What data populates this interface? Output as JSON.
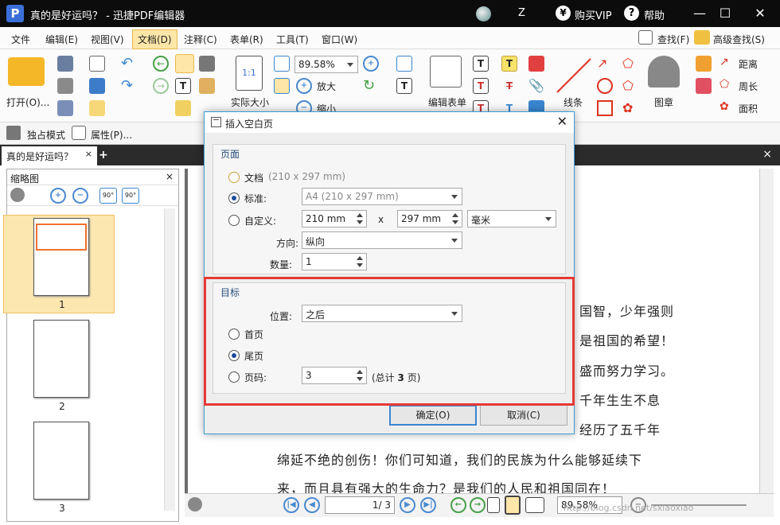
{
  "window": {
    "title": "真的是好运吗？ - 迅捷PDF编辑器",
    "logo": "P",
    "user": "Z",
    "vip_label": "购买VIP",
    "vip_icon": "¥",
    "help_label": "帮助",
    "help_icon": "?"
  },
  "menu": {
    "items": [
      "文件",
      "编辑(E)",
      "视图(V)",
      "文档(D)",
      "注释(C)",
      "表单(R)",
      "工具(T)",
      "窗口(W)"
    ],
    "find": "查找(F)",
    "advanced_find": "高级查找(S)"
  },
  "ribbon": {
    "open": "打开(O)...",
    "zoom_value": "89.58%",
    "actual_size": "实际大小",
    "actual_size_icon": "1:1",
    "zoom_in": "放大",
    "zoom_out": "缩小",
    "edit_form": "编辑表单",
    "lines": "线条",
    "stamp": "图章",
    "distance": "距离",
    "perimeter": "周长",
    "area": "面积"
  },
  "toolbar2": {
    "solo_mode": "独占模式",
    "properties": "属性(P)..."
  },
  "tabs": {
    "doc_tab": "真的是好运吗？",
    "close": "×",
    "add": "+"
  },
  "sidebar": {
    "title": "缩略图",
    "close": "×",
    "rotate_left": "90°",
    "rotate_right": "90°",
    "pages": [
      "1",
      "2",
      "3"
    ]
  },
  "document": {
    "lines": [
      "国智，少年强则",
      "是祖国的希望！",
      "盛而努力学习。",
      "千年生生不息",
      "经历了五千年",
      "绵延不绝的创伤！你们可知道，我们的民族为什么能够延续下",
      "来，而且具有强大的生命力？是我们的人民和祖国同在！"
    ]
  },
  "statusbar": {
    "page_current": "1",
    "page_total": "/ 3",
    "zoom": "89.58%",
    "watermark": "http://blog.csdn.net/sxiaoxiao"
  },
  "dialog": {
    "title": "插入空白页",
    "close": "✕",
    "page_section": {
      "legend": "页面",
      "doc_option": "文档",
      "doc_size": "(210 x 297 mm)",
      "standard_option": "标准:",
      "standard_value": "A4 (210 x 297 mm)",
      "custom_option": "自定义:",
      "width": "210 mm",
      "times": "x",
      "height": "297 mm",
      "unit": "毫米",
      "orientation_label": "方向:",
      "orientation_value": "纵向",
      "count_label": "数量:",
      "count_value": "1"
    },
    "target_section": {
      "legend": "目标",
      "position_label": "位置:",
      "position_value": "之后",
      "first_page": "首页",
      "last_page": "尾页",
      "page_number": "页码:",
      "page_number_value": "3",
      "total_prefix": "(总计",
      "total_value": "3",
      "total_suffix": "页)"
    },
    "ok": "确定(O)",
    "cancel": "取消(C)"
  },
  "colors": {
    "highlight_box": "#e53935",
    "accent": "#3a86d0",
    "active_menu": "#fde6a8"
  }
}
